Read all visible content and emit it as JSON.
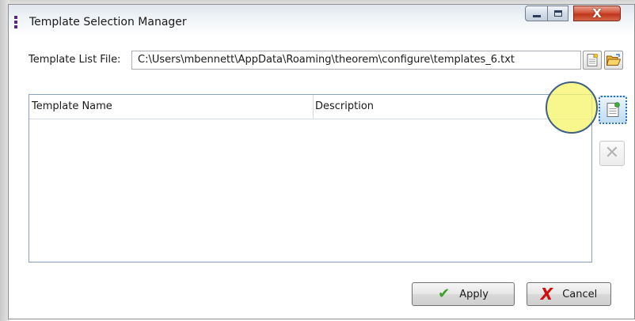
{
  "window": {
    "title": "Template Selection Manager",
    "controls": {
      "minimize": "minimize",
      "maximize": "maximize",
      "close": "X"
    }
  },
  "template_list_file": {
    "label": "Template List File:",
    "value": "C:\\Users\\mbennett\\AppData\\Roaming\\theorem\\configure\\templates_6.txt"
  },
  "templates_grid": {
    "columns": [
      "Template Name",
      "Description"
    ],
    "rows": []
  },
  "side_buttons": {
    "add": "add-template-icon",
    "delete": "delete-template-icon"
  },
  "footer": {
    "apply_label": "Apply",
    "cancel_label": "Cancel"
  },
  "colors": {
    "highlight": "#f5f56e",
    "apply_check": "#3aa02a",
    "cancel_x": "#d01010",
    "close_button": "#c0371c"
  }
}
